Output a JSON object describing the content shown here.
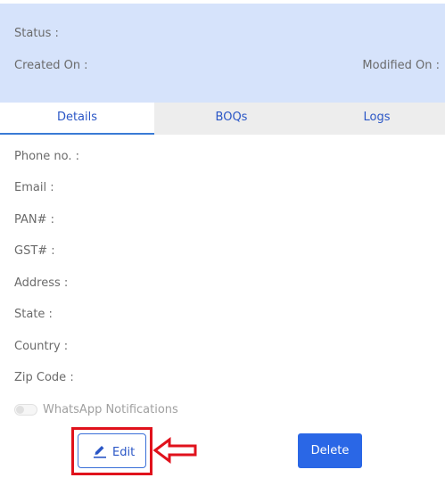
{
  "header": {
    "status_label": "Status :",
    "created_label": "Created On :",
    "modified_label": "Modified On :"
  },
  "tabs": [
    {
      "label": "Details",
      "active": true
    },
    {
      "label": "BOQs",
      "active": false
    },
    {
      "label": "Logs",
      "active": false
    }
  ],
  "fields": {
    "phone": "Phone no. :",
    "email": "Email :",
    "pan": "PAN# :",
    "gst": "GST# :",
    "address": "Address :",
    "state": "State :",
    "country": "Country :",
    "zip": "Zip Code :"
  },
  "whatsapp": {
    "label": "WhatsApp Notifications",
    "enabled": false
  },
  "actions": {
    "edit_label": "Edit",
    "delete_label": "Delete"
  },
  "colors": {
    "header_bg": "#d6e3fb",
    "accent": "#2a67e6",
    "highlight": "#e0121c"
  },
  "icons": {
    "edit": "pencil-icon",
    "annotation": "left-arrow-icon"
  }
}
